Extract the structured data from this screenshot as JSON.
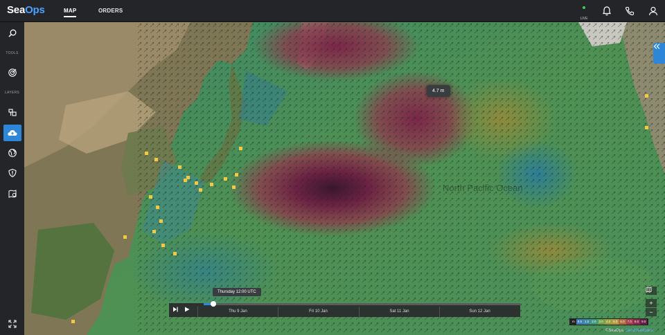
{
  "app": {
    "logo_part1": "Sea",
    "logo_part2": "Ops"
  },
  "nav": {
    "tabs": [
      {
        "label": "MAP",
        "active": true
      },
      {
        "label": "ORDERS",
        "active": false
      }
    ]
  },
  "status": {
    "live_label": "LIVE"
  },
  "sidebar": {
    "tools_label": "TOOLS",
    "layers_label": "LAYERS"
  },
  "map": {
    "wave_tooltip": "4.7 m",
    "ocean_label": "North Pacific Ocean"
  },
  "timeline": {
    "current_time": "Thursday 12:00 UTC",
    "days": [
      "Thu 9 Jan",
      "Fri 10 Jan",
      "Sat 11 Jan",
      "Sun 12 Jan"
    ],
    "progress": 0.03
  },
  "map_controls": {
    "zoom_in": "+",
    "zoom_out": "−"
  },
  "legend": {
    "unit": "m",
    "values": [
      "0.5",
      "1.0",
      "2.0",
      "3.0",
      "4.0",
      "5.0",
      "6.0",
      "7.0",
      "8.0",
      "9.0"
    ],
    "colors": [
      "#3f7fb8",
      "#3b8aa3",
      "#3c9a7c",
      "#6aa34a",
      "#9aa23a",
      "#b39a3a",
      "#b46a3d",
      "#a63e4b",
      "#8e2a4e",
      "#6a1d45"
    ]
  },
  "attribution": {
    "copyright": "©SeaOps",
    "feedback_link": "Send feedback"
  },
  "colors": {
    "accent": "#2e86d9",
    "live": "#39d353"
  }
}
